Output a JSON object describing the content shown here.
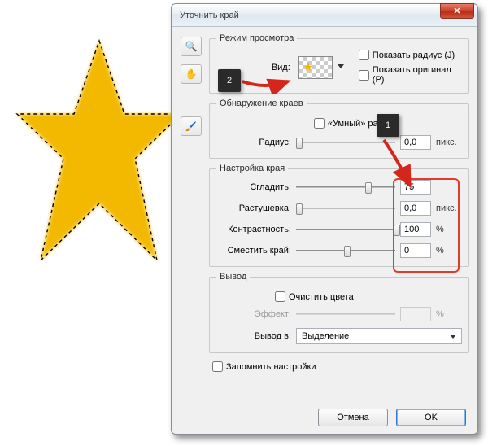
{
  "dialog": {
    "title": "Уточнить край"
  },
  "view_mode": {
    "legend": "Режим просмотра",
    "view_label": "Вид:",
    "show_radius_label": "Показать радиус (J)",
    "show_original_label": "Показать оригинал (P)"
  },
  "edge_detection": {
    "legend": "Обнаружение краев",
    "smart_radius_label": "«Умный» радиус",
    "radius_label": "Радиус:",
    "radius_value": "0,0",
    "radius_unit": "пикс."
  },
  "adjust_edge": {
    "legend": "Настройка края",
    "smooth_label": "Сгладить:",
    "smooth_value": "75",
    "feather_label": "Растушевка:",
    "feather_value": "0,0",
    "feather_unit": "пикс.",
    "contrast_label": "Контрастность:",
    "contrast_value": "100",
    "contrast_unit": "%",
    "shift_label": "Сместить край:",
    "shift_value": "0",
    "shift_unit": "%"
  },
  "output": {
    "legend": "Вывод",
    "decontaminate_label": "Очистить цвета",
    "amount_label": "Эффект:",
    "amount_unit": "%",
    "output_to_label": "Вывод в:",
    "output_to_value": "Выделение"
  },
  "remember": {
    "label": "Запомнить настройки"
  },
  "footer": {
    "cancel": "Отмена",
    "ok": "OK"
  },
  "callouts": {
    "one": "1",
    "two": "2"
  },
  "colors": {
    "star_fill": "#f3b900",
    "highlight": "#e23b2a",
    "arrow": "#d4261a"
  }
}
